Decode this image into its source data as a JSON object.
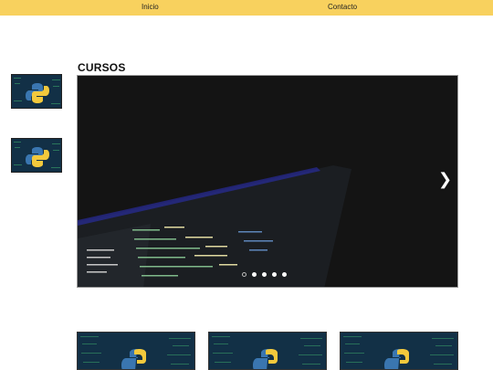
{
  "nav": {
    "items": [
      {
        "label": "Inicio"
      },
      {
        "label": "Contacto"
      }
    ]
  },
  "section": {
    "title": "CURSOS"
  },
  "colors": {
    "nav_bg": "#f8d15e",
    "python_blue": "#3a76b0",
    "python_yellow": "#f3c93c",
    "code_bg": "#0f1f2c"
  },
  "carousel": {
    "slides": 5,
    "active": 0
  },
  "thumbnails": [
    {
      "icon": "python-logo-icon"
    },
    {
      "icon": "python-logo-icon"
    }
  ],
  "cards": [
    {
      "icon": "python-logo-icon"
    },
    {
      "icon": "python-logo-icon"
    },
    {
      "icon": "python-logo-icon"
    }
  ]
}
